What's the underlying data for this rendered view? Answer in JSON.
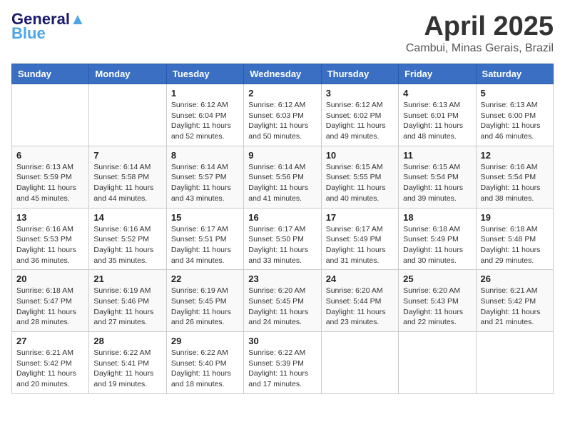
{
  "logo": {
    "text1": "General",
    "text2": "Blue"
  },
  "title": "April 2025",
  "subtitle": "Cambui, Minas Gerais, Brazil",
  "days_of_week": [
    "Sunday",
    "Monday",
    "Tuesday",
    "Wednesday",
    "Thursday",
    "Friday",
    "Saturday"
  ],
  "weeks": [
    [
      {
        "day": "",
        "info": ""
      },
      {
        "day": "",
        "info": ""
      },
      {
        "day": "1",
        "info": "Sunrise: 6:12 AM\nSunset: 6:04 PM\nDaylight: 11 hours and 52 minutes."
      },
      {
        "day": "2",
        "info": "Sunrise: 6:12 AM\nSunset: 6:03 PM\nDaylight: 11 hours and 50 minutes."
      },
      {
        "day": "3",
        "info": "Sunrise: 6:12 AM\nSunset: 6:02 PM\nDaylight: 11 hours and 49 minutes."
      },
      {
        "day": "4",
        "info": "Sunrise: 6:13 AM\nSunset: 6:01 PM\nDaylight: 11 hours and 48 minutes."
      },
      {
        "day": "5",
        "info": "Sunrise: 6:13 AM\nSunset: 6:00 PM\nDaylight: 11 hours and 46 minutes."
      }
    ],
    [
      {
        "day": "6",
        "info": "Sunrise: 6:13 AM\nSunset: 5:59 PM\nDaylight: 11 hours and 45 minutes."
      },
      {
        "day": "7",
        "info": "Sunrise: 6:14 AM\nSunset: 5:58 PM\nDaylight: 11 hours and 44 minutes."
      },
      {
        "day": "8",
        "info": "Sunrise: 6:14 AM\nSunset: 5:57 PM\nDaylight: 11 hours and 43 minutes."
      },
      {
        "day": "9",
        "info": "Sunrise: 6:14 AM\nSunset: 5:56 PM\nDaylight: 11 hours and 41 minutes."
      },
      {
        "day": "10",
        "info": "Sunrise: 6:15 AM\nSunset: 5:55 PM\nDaylight: 11 hours and 40 minutes."
      },
      {
        "day": "11",
        "info": "Sunrise: 6:15 AM\nSunset: 5:54 PM\nDaylight: 11 hours and 39 minutes."
      },
      {
        "day": "12",
        "info": "Sunrise: 6:16 AM\nSunset: 5:54 PM\nDaylight: 11 hours and 38 minutes."
      }
    ],
    [
      {
        "day": "13",
        "info": "Sunrise: 6:16 AM\nSunset: 5:53 PM\nDaylight: 11 hours and 36 minutes."
      },
      {
        "day": "14",
        "info": "Sunrise: 6:16 AM\nSunset: 5:52 PM\nDaylight: 11 hours and 35 minutes."
      },
      {
        "day": "15",
        "info": "Sunrise: 6:17 AM\nSunset: 5:51 PM\nDaylight: 11 hours and 34 minutes."
      },
      {
        "day": "16",
        "info": "Sunrise: 6:17 AM\nSunset: 5:50 PM\nDaylight: 11 hours and 33 minutes."
      },
      {
        "day": "17",
        "info": "Sunrise: 6:17 AM\nSunset: 5:49 PM\nDaylight: 11 hours and 31 minutes."
      },
      {
        "day": "18",
        "info": "Sunrise: 6:18 AM\nSunset: 5:49 PM\nDaylight: 11 hours and 30 minutes."
      },
      {
        "day": "19",
        "info": "Sunrise: 6:18 AM\nSunset: 5:48 PM\nDaylight: 11 hours and 29 minutes."
      }
    ],
    [
      {
        "day": "20",
        "info": "Sunrise: 6:18 AM\nSunset: 5:47 PM\nDaylight: 11 hours and 28 minutes."
      },
      {
        "day": "21",
        "info": "Sunrise: 6:19 AM\nSunset: 5:46 PM\nDaylight: 11 hours and 27 minutes."
      },
      {
        "day": "22",
        "info": "Sunrise: 6:19 AM\nSunset: 5:45 PM\nDaylight: 11 hours and 26 minutes."
      },
      {
        "day": "23",
        "info": "Sunrise: 6:20 AM\nSunset: 5:45 PM\nDaylight: 11 hours and 24 minutes."
      },
      {
        "day": "24",
        "info": "Sunrise: 6:20 AM\nSunset: 5:44 PM\nDaylight: 11 hours and 23 minutes."
      },
      {
        "day": "25",
        "info": "Sunrise: 6:20 AM\nSunset: 5:43 PM\nDaylight: 11 hours and 22 minutes."
      },
      {
        "day": "26",
        "info": "Sunrise: 6:21 AM\nSunset: 5:42 PM\nDaylight: 11 hours and 21 minutes."
      }
    ],
    [
      {
        "day": "27",
        "info": "Sunrise: 6:21 AM\nSunset: 5:42 PM\nDaylight: 11 hours and 20 minutes."
      },
      {
        "day": "28",
        "info": "Sunrise: 6:22 AM\nSunset: 5:41 PM\nDaylight: 11 hours and 19 minutes."
      },
      {
        "day": "29",
        "info": "Sunrise: 6:22 AM\nSunset: 5:40 PM\nDaylight: 11 hours and 18 minutes."
      },
      {
        "day": "30",
        "info": "Sunrise: 6:22 AM\nSunset: 5:39 PM\nDaylight: 11 hours and 17 minutes."
      },
      {
        "day": "",
        "info": ""
      },
      {
        "day": "",
        "info": ""
      },
      {
        "day": "",
        "info": ""
      }
    ]
  ]
}
